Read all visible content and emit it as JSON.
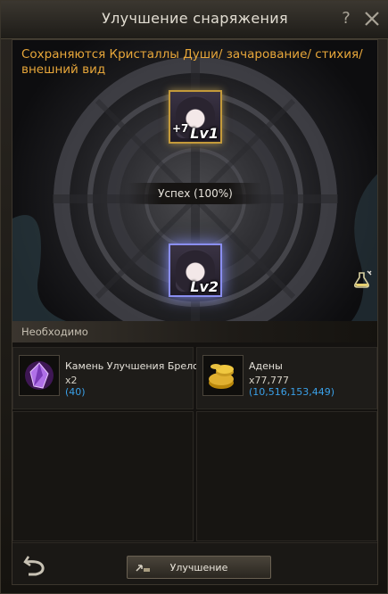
{
  "window": {
    "title": "Улучшение снаряжения",
    "help_label": "?"
  },
  "notice": "Сохраняются Кристаллы Души/ зачарование/ стихия/ внешний вид",
  "source_item": {
    "enchant": "+7",
    "level": "Lv1",
    "icon": "doll-icon"
  },
  "success_text": "Успех (100%)",
  "result_item": {
    "level": "Lv2",
    "icon": "doll-icon"
  },
  "requirements": {
    "header": "Необходимо",
    "items": [
      {
        "name": "Камень Улучшения Брелока",
        "qty": "x2",
        "have": "(40)",
        "icon": "purple-crystal-icon"
      },
      {
        "name": "Адены",
        "qty": "x77,777",
        "have": "(10,516,153,449)",
        "icon": "gold-coins-icon"
      }
    ]
  },
  "footer": {
    "upgrade_label": "Улучшение"
  },
  "colors": {
    "notice": "#e8a73a",
    "have_count": "#3aa0e8",
    "result_glow": "#8a8ef0"
  }
}
